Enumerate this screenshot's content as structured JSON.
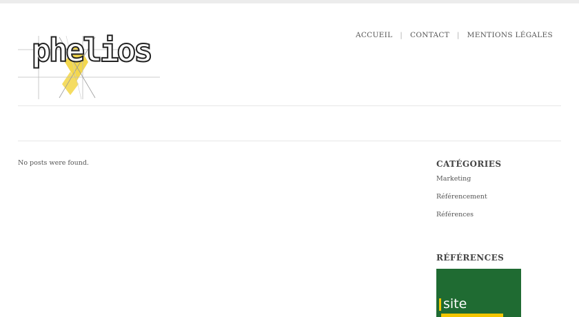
{
  "logo": {
    "text": "phelios",
    "accent_color": "#f2d33a"
  },
  "nav": {
    "items": [
      {
        "label": "ACCUEIL"
      },
      {
        "label": "CONTACT"
      },
      {
        "label": "MENTIONS LÉGALES"
      }
    ],
    "separator": "|"
  },
  "main": {
    "empty_message": "No posts were found."
  },
  "sidebar": {
    "categories": {
      "title": "CATÉGORIES",
      "items": [
        {
          "label": "Marketing"
        },
        {
          "label": "Référencement"
        },
        {
          "label": "Références"
        }
      ]
    },
    "references": {
      "title": "RÉFÉRENCES",
      "image_text": "site",
      "image_bg_color": "#1f6b32",
      "image_accent_color": "#f2c500"
    }
  }
}
